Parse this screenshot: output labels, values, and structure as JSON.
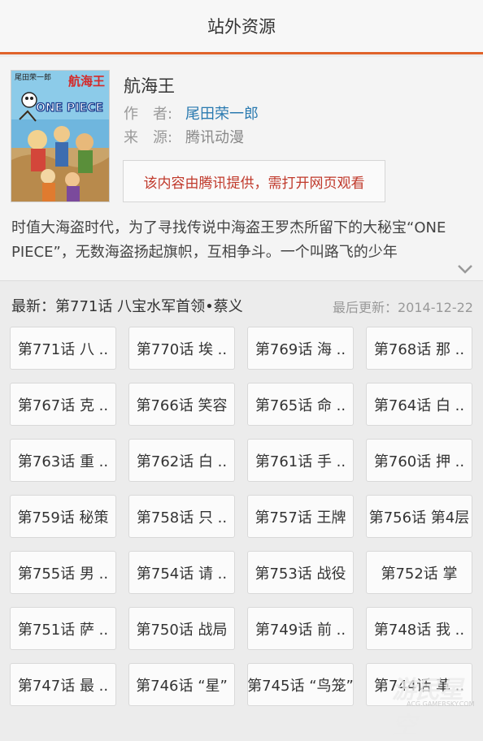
{
  "header": {
    "title": "站外资源"
  },
  "book": {
    "title": "航海王",
    "author_label": "作　者:",
    "author": "尾田荣一郎",
    "source_label": "来　源:",
    "source": "腾讯动漫",
    "notice": "该内容由腾讯提供，需打开网页观看",
    "cover": {
      "author_text": "尾田荣一郎",
      "title_text": "航海王",
      "logo_text": "ONE PIECE"
    }
  },
  "description": {
    "text": "时值大海盗时代，为了寻找传说中海盗王罗杰所留下的大秘宝“ONE PIECE”，无数海盗扬起旗帜，互相争斗。一个叫路飞的少年"
  },
  "latest": {
    "text": "最新：第771话 八宝水军首领•蔡义",
    "updated": "最后更新：2014-12-22"
  },
  "episodes": [
    "第771话 八 ..",
    "第770话 埃 ..",
    "第769话 海 ..",
    "第768话 那 ..",
    "第767话 克 ..",
    "第766话 笑容",
    "第765话 命 ..",
    "第764话 白 ..",
    "第763话 重 ..",
    "第762话 白 ..",
    "第761话 手 ..",
    "第760话 押 ..",
    "第759话 秘策",
    "第758话 只 ..",
    "第757话 王牌",
    "第756话 第4层",
    "第755话 男 ..",
    "第754话 请 ..",
    "第753话 战役",
    "第752话 掌",
    "第751话 萨 ..",
    "第750话 战局",
    "第749话 前 ..",
    "第748话 我 ..",
    "第747话 最 ..",
    "第746话 “星”",
    "第745话 “鸟笼”",
    "第744话 革 .."
  ],
  "watermark": {
    "main": "游民星空",
    "sub": "ACG.GAMERSKY.COM"
  },
  "colors": {
    "accent": "#e0632a",
    "author": "#2a7ab0",
    "notice": "#c0392b"
  }
}
